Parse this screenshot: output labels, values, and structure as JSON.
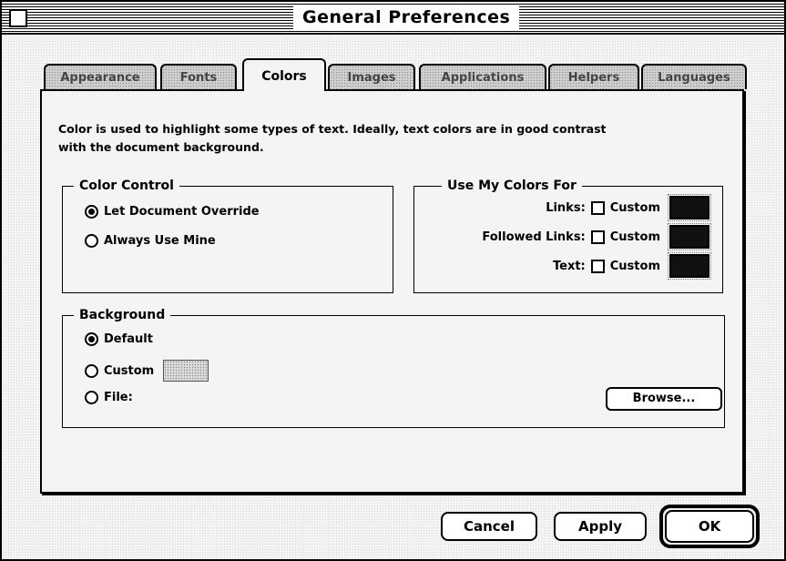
{
  "window": {
    "title": "General Preferences"
  },
  "tabs": [
    {
      "label": "Appearance"
    },
    {
      "label": "Fonts"
    },
    {
      "label": "Colors"
    },
    {
      "label": "Images"
    },
    {
      "label": "Applications"
    },
    {
      "label": "Helpers"
    },
    {
      "label": "Languages"
    }
  ],
  "active_tab": "Colors",
  "description": "Color is used to highlight some types of text. Ideally, text colors are in good contrast with the document background.",
  "color_control": {
    "legend": "Color Control",
    "options": [
      {
        "label": "Let Document Override",
        "selected": true
      },
      {
        "label": "Always Use Mine",
        "selected": false
      }
    ]
  },
  "use_my_colors": {
    "legend": "Use My Colors For",
    "rows": [
      {
        "label": "Links:",
        "checkbox_label": "Custom",
        "checked": false,
        "swatch_color": "#111111"
      },
      {
        "label": "Followed Links:",
        "checkbox_label": "Custom",
        "checked": false,
        "swatch_color": "#111111"
      },
      {
        "label": "Text:",
        "checkbox_label": "Custom",
        "checked": false,
        "swatch_color": "#111111"
      }
    ]
  },
  "background": {
    "legend": "Background",
    "options": [
      {
        "label": "Default",
        "selected": true
      },
      {
        "label": "Custom",
        "selected": false
      },
      {
        "label": "File:",
        "selected": false
      }
    ],
    "browse_label": "Browse..."
  },
  "buttons": {
    "cancel": "Cancel",
    "apply": "Apply",
    "ok": "OK"
  }
}
